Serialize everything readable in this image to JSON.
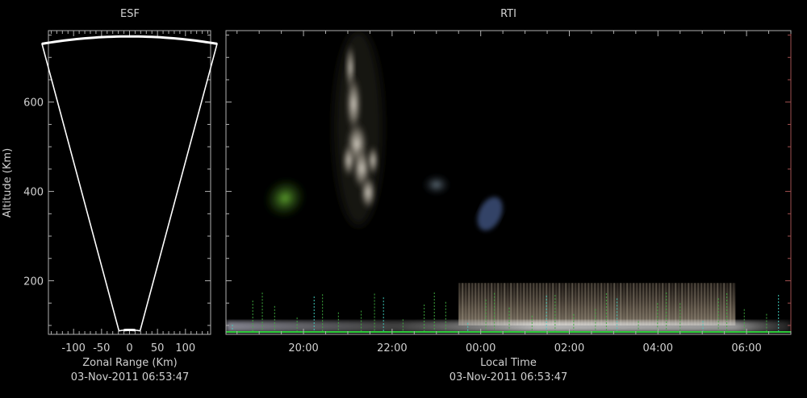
{
  "chart_data": [
    {
      "type": "fan",
      "title": "ESF",
      "xlabel": "Zonal Range (Km)",
      "ylabel": "Altitude (Km)",
      "subtitle": "03-Nov-2011 06:53:47",
      "xlim": [
        -145,
        145
      ],
      "ylim": [
        80,
        760
      ],
      "xticks": [
        -100,
        -50,
        0,
        50,
        100
      ],
      "xtick_labels": [
        "-100",
        "-50",
        "0",
        "50",
        "100"
      ],
      "yticks": [
        200,
        400,
        600
      ],
      "ytick_labels": [
        "200",
        "400",
        "600"
      ],
      "fan": {
        "min_range_km": 90,
        "max_range_km": 747,
        "half_angle_deg": 12.1
      },
      "colors": {
        "outline": "#ffffff",
        "axis": "#b0b0b0"
      }
    },
    {
      "type": "heatmap",
      "title": "RTI",
      "xlabel": "Local Time",
      "subtitle": "03-Nov-2011 06:53:47",
      "xlim": [
        "2011-11-02T18:15",
        "2011-11-03T07:00"
      ],
      "ylim": [
        80,
        760
      ],
      "xticks": [
        "2011-11-02T20:00",
        "2011-11-02T22:00",
        "2011-11-03T00:00",
        "2011-11-03T02:00",
        "2011-11-03T04:00",
        "2011-11-03T06:00"
      ],
      "xtick_labels": [
        "20:00",
        "22:00",
        "00:00",
        "02:00",
        "04:00",
        "06:00"
      ],
      "yticks": [
        200,
        400,
        600
      ],
      "grid": false,
      "echo_regions": [
        {
          "name": "plume-core",
          "time_start": "2011-11-02T20:40",
          "time_end": "2011-11-02T21:40",
          "alt_bottom": 300,
          "alt_top": 740,
          "color": "#c9c3b8"
        },
        {
          "name": "green-patch",
          "time_start": "2011-11-02T19:05",
          "time_end": "2011-11-02T20:05",
          "alt_bottom": 340,
          "alt_top": 430,
          "color": "#3c7a1c"
        },
        {
          "name": "mid-patch",
          "time_start": "2011-11-02T22:40",
          "time_end": "2011-11-02T23:20",
          "alt_bottom": 390,
          "alt_top": 440,
          "color": "#3a5a4a"
        },
        {
          "name": "blue-streak",
          "time_start": "2011-11-02T23:50",
          "time_end": "2011-11-03T00:35",
          "alt_bottom": 310,
          "alt_top": 390,
          "color": "#445a8a"
        },
        {
          "name": "lower-layer",
          "time_start": "2011-11-02T23:30",
          "time_end": "2011-11-03T05:45",
          "alt_bottom": 100,
          "alt_top": 195,
          "color": "#5a4d40"
        },
        {
          "name": "bottom-band",
          "time_start": "2011-11-02T18:15",
          "time_end": "2011-11-03T07:00",
          "alt_bottom": 85,
          "alt_top": 110,
          "color": "#d8d8d8"
        }
      ],
      "colors": {
        "axis": "#b0b0b0",
        "right_axis": "#a05050",
        "green_baseline": "#2ecc3a"
      }
    }
  ]
}
